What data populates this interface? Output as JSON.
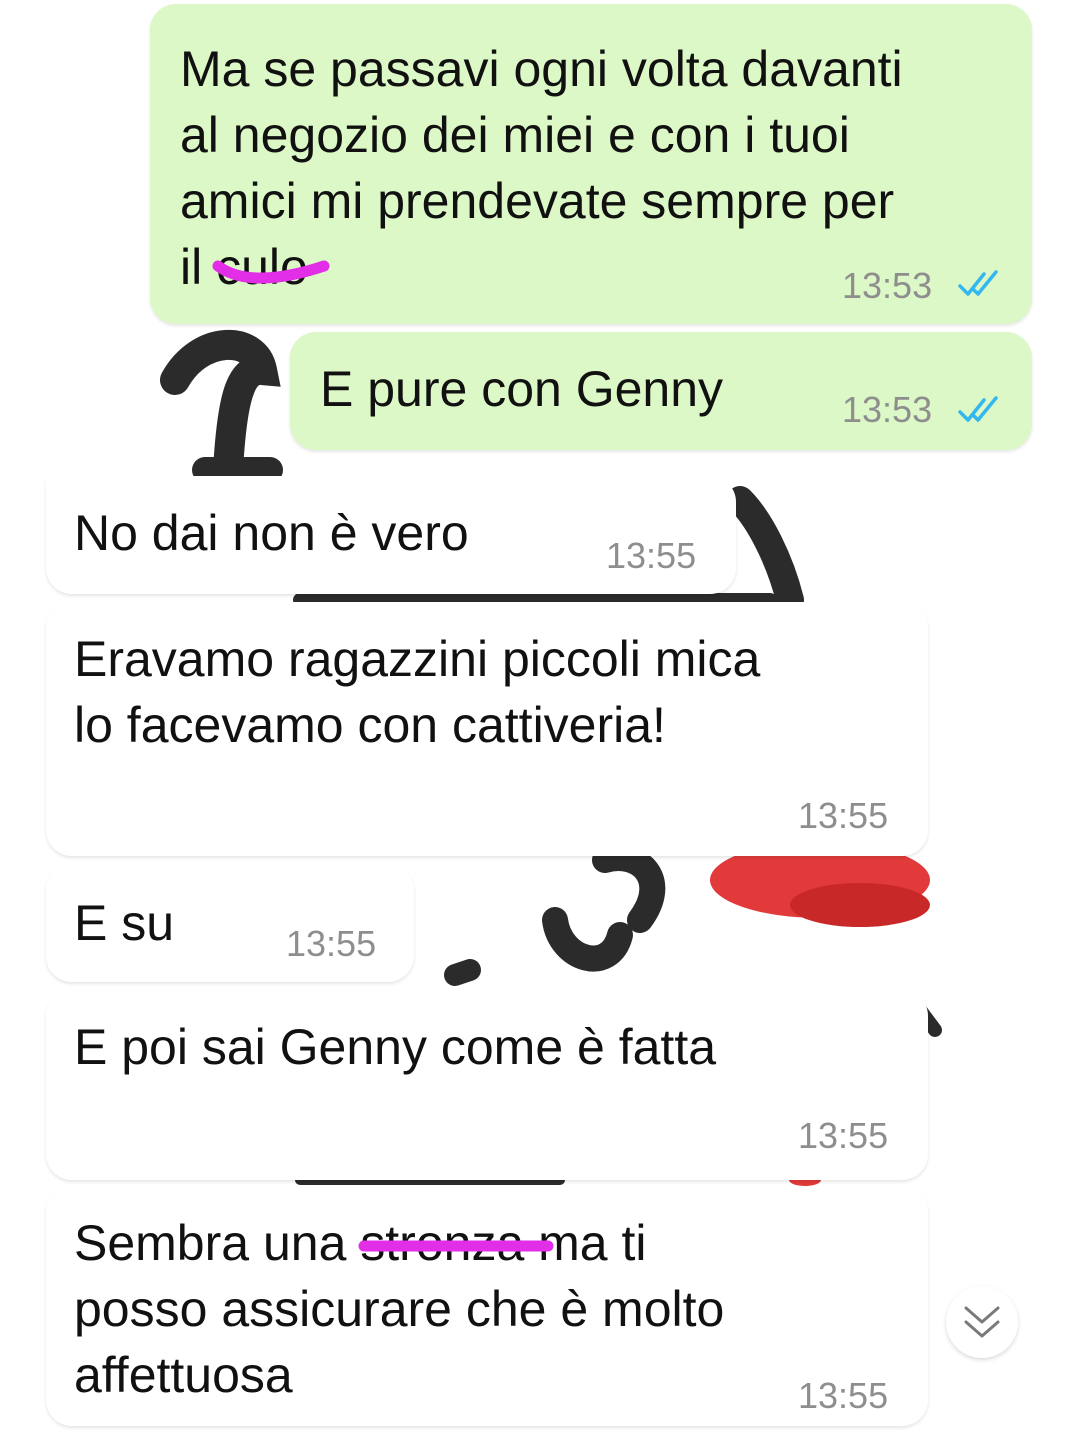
{
  "colors": {
    "outgoing_bubble": "#dcf8c6",
    "incoming_bubble": "#ffffff",
    "read_ticks": "#34b7f1",
    "redaction": "#e22ee6",
    "timestamp": "#8e8e8e"
  },
  "messages": [
    {
      "direction": "outgoing",
      "lines": [
        "Ma se passavi ogni volta davanti",
        "al negozio dei miei e con i tuoi",
        "amici mi prendevate sempre per",
        "il "
      ],
      "redacted_word": "culo",
      "time": "13:53",
      "status_icon": "double-check-read-icon"
    },
    {
      "direction": "outgoing",
      "lines": [
        "E pure con Genny"
      ],
      "time": "13:53",
      "status_icon": "double-check-read-icon"
    },
    {
      "direction": "incoming",
      "lines": [
        "No dai non è vero"
      ],
      "time": "13:55"
    },
    {
      "direction": "incoming",
      "lines": [
        "Eravamo ragazzini piccoli mica",
        "lo facevamo con cattiveria!"
      ],
      "time": "13:55"
    },
    {
      "direction": "incoming",
      "lines": [
        "E su"
      ],
      "time": "13:55"
    },
    {
      "direction": "incoming",
      "lines": [
        "E poi sai Genny come è fatta"
      ],
      "time": "13:55"
    },
    {
      "direction": "incoming",
      "lines": [
        "Sembra una ",
        "posso assicurare che è molto",
        "affettuosa"
      ],
      "redacted_word": "stronza",
      "line1_suffix": " ma ti",
      "time": "13:55"
    }
  ],
  "scroll_to_bottom_icon": "double-chevron-down-icon"
}
